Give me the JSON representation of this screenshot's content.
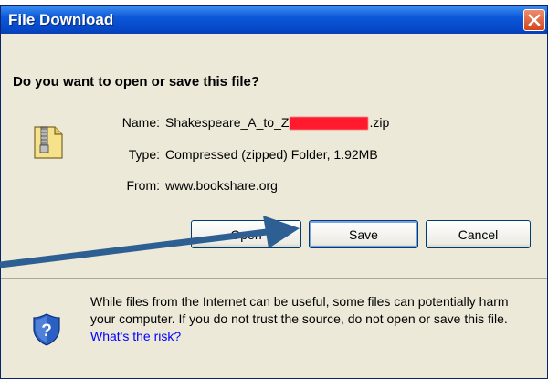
{
  "dialog": {
    "title": "File Download",
    "question": "Do you want to open or save this file?",
    "file": {
      "name_label": "Name:",
      "name_prefix": "Shakespeare_A_to_Z",
      "name_suffix": ".zip",
      "type_label": "Type:",
      "type_value": "Compressed (zipped) Folder, 1.92MB",
      "from_label": "From:",
      "from_value": "www.bookshare.org"
    },
    "buttons": {
      "open": "Open",
      "save": "Save",
      "cancel": "Cancel"
    },
    "warning": {
      "text": "While files from the Internet can be useful, some files can potentially harm your computer. If you do not trust the source, do not open or save this file.",
      "link": "What's the risk?"
    }
  },
  "icons": {
    "close": "close-icon",
    "file": "zip-folder-icon",
    "shield": "security-shield-icon",
    "arrow": "pointer-arrow-icon"
  },
  "colors": {
    "titlebar": "#0a58d8",
    "dialog_bg": "#ece9d8",
    "arrow": "#2e5f93",
    "redaction": "#ff1a2e",
    "link": "#0000ff"
  }
}
